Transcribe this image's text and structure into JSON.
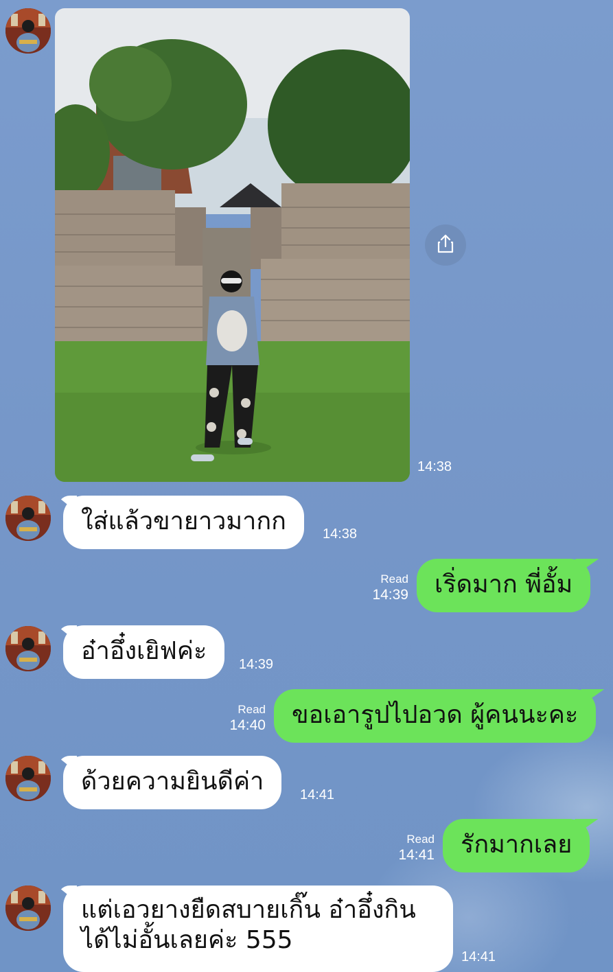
{
  "colors": {
    "background": "#7596c8",
    "incoming_bubble": "#ffffff",
    "outgoing_bubble": "#6ce35a",
    "timestamp_text": "#ffffff"
  },
  "messages": [
    {
      "id": "m1",
      "direction": "incoming",
      "type": "photo",
      "icon": "share-icon",
      "time": "14:38"
    },
    {
      "id": "m2",
      "direction": "incoming",
      "text": "ใส่แล้วขายาวมากก",
      "time": "14:38"
    },
    {
      "id": "m3",
      "direction": "outgoing",
      "text": "เริ่ดมาก พี่อั้ม",
      "read": "Read",
      "time": "14:39"
    },
    {
      "id": "m4",
      "direction": "incoming",
      "text": "อ๋าอึ๋งเยิฟค่ะ",
      "time": "14:39"
    },
    {
      "id": "m5",
      "direction": "outgoing",
      "text": "ขอเอารูปไปอวด ผู้คนนะคะ",
      "read": "Read",
      "time": "14:40"
    },
    {
      "id": "m6",
      "direction": "incoming",
      "text": "ด้วยความยินดีค่า",
      "time": "14:41"
    },
    {
      "id": "m7",
      "direction": "outgoing",
      "text": "รักมากเลย",
      "read": "Read",
      "time": "14:41"
    },
    {
      "id": "m8",
      "direction": "incoming",
      "text_line1": "แต่เอวยางยืดสบายเกิ๊น อ๋าอึ๋งกิน",
      "text_line2": "ได้ไม่อั้นเลยค่ะ 555",
      "time": "14:41"
    }
  ]
}
